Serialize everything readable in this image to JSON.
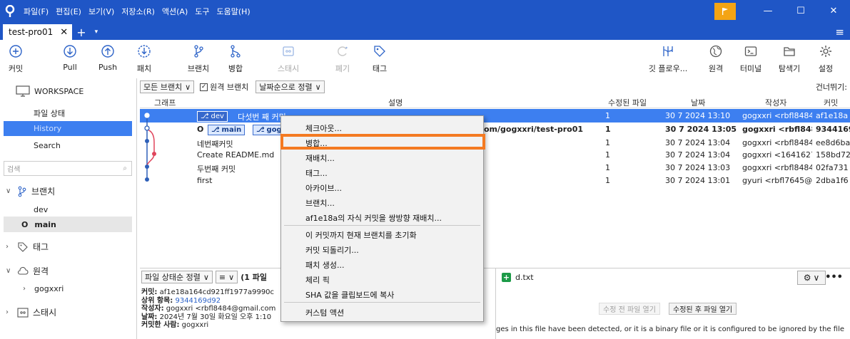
{
  "titlebar": {
    "menu": [
      "파일(F)",
      "편집(E)",
      "보기(V)",
      "저장소(R)",
      "액션(A)",
      "도구",
      "도움말(H)"
    ],
    "window_controls": [
      "—",
      "☐",
      "✕"
    ]
  },
  "tabbar": {
    "tab_label": "test-pro01",
    "close": "✕",
    "new": "+",
    "dropdown": "▾",
    "menu": "≡"
  },
  "toolbar": {
    "commit": "커밋",
    "pull": "Pull",
    "push": "Push",
    "fetch": "패치",
    "branch": "브랜치",
    "merge": "병합",
    "stash": "스태시",
    "discard": "폐기",
    "tag": "태그",
    "gitflow": "깃 플로우...",
    "remote": "원격",
    "terminal": "터미널",
    "explorer": "탐색기",
    "settings": "설정"
  },
  "sidebar": {
    "workspace": "WORKSPACE",
    "file_status": "파일 상태",
    "history": "History",
    "search": "Search",
    "search_placeholder": "검색",
    "branches": "브랜치",
    "branch_dev": "dev",
    "branch_main": "main",
    "tags": "태그",
    "remotes": "원격",
    "remote_name": "gogxxri",
    "submodules": "스태시"
  },
  "filterbar": {
    "all_branches": "모든 브랜치",
    "remote_branch": "원격 브랜치",
    "date_sort": "날짜순으로 정렬",
    "skip": "건너뛰기:"
  },
  "columns": {
    "graph": "그래프",
    "desc": "설명",
    "modified": "수정된 파일",
    "date": "날짜",
    "author": "작성자",
    "commit": "커밋"
  },
  "commits": [
    {
      "desc": "다섯번 째 커밋",
      "modified": "1",
      "date": "30 7 2024 13:10",
      "author": "gogxxri <rbfl8484",
      "hash": "af1e18a",
      "branch": "dev"
    },
    {
      "desc": "om/gogxxri/test-pro01",
      "modified": "1",
      "date": "30 7 2024 13:05",
      "author": "gogxxri <rbfl848",
      "hash": "9344169",
      "branch": "main",
      "branch2": "gog"
    },
    {
      "desc": "네번째커밋",
      "modified": "1",
      "date": "30 7 2024 13:04",
      "author": "gogxxri <rbfl8484",
      "hash": "ee8d6ba"
    },
    {
      "desc": "Create README.md",
      "modified": "1",
      "date": "30 7 2024 13:04",
      "author": "gogxxri <1641627",
      "hash": "158bd72"
    },
    {
      "desc": "두번째 커밋",
      "modified": "1",
      "date": "30 7 2024 13:03",
      "author": "gogxxri <rbfl8484",
      "hash": "02fa731"
    },
    {
      "desc": "first",
      "modified": "1",
      "date": "30 7 2024 13:01",
      "author": "gyuri <rbfl7645@",
      "hash": "2dba1f6"
    }
  ],
  "bottom_left": {
    "sort": "파일 상태순 정렬",
    "list": "≡",
    "count": "(1 파일",
    "info_commit_label": "커밋:",
    "info_commit": "af1e18a164cd921ff1977a9990c",
    "info_parent_label": "상위 항목:",
    "info_parent": "9344169d92",
    "info_author_label": "작성자:",
    "info_author": "gogxxri <rbfl8484@gmail.com",
    "info_date_label": "날짜:",
    "info_date": "2024년 7월 30일 화요일 오후 1:10",
    "info_committer_label": "커밋한 사람:",
    "info_committer": "gogxxri"
  },
  "bottom_right": {
    "file": "d.txt",
    "open_before": "수정 전 파일 열기",
    "open_after": "수정된 후 파일 열기",
    "message": "ges in this file have been detected, or it is a binary file or it is configured to be ignored by the file"
  },
  "context_menu": {
    "checkout": "체크아웃...",
    "merge": "병합...",
    "rebase": "재배치...",
    "tag": "태그...",
    "archive": "아카이브...",
    "branch": "브랜치...",
    "interactive_rebase": "af1e18a의 자식 커밋을 쌍방향 재배치...",
    "reset": "이 커밋까지 현재 브랜치를 초기화",
    "revert": "커밋 되돌리기...",
    "patch": "패치 생성...",
    "cherry_pick": "체리 픽",
    "copy_sha": "SHA 값을 클립보드에 복사",
    "custom": "커스텀 액션"
  },
  "colors": {
    "accent": "#1f56c6",
    "selection": "#3d7ff0",
    "highlight": "#f47a22",
    "flag": "#f4a414"
  }
}
